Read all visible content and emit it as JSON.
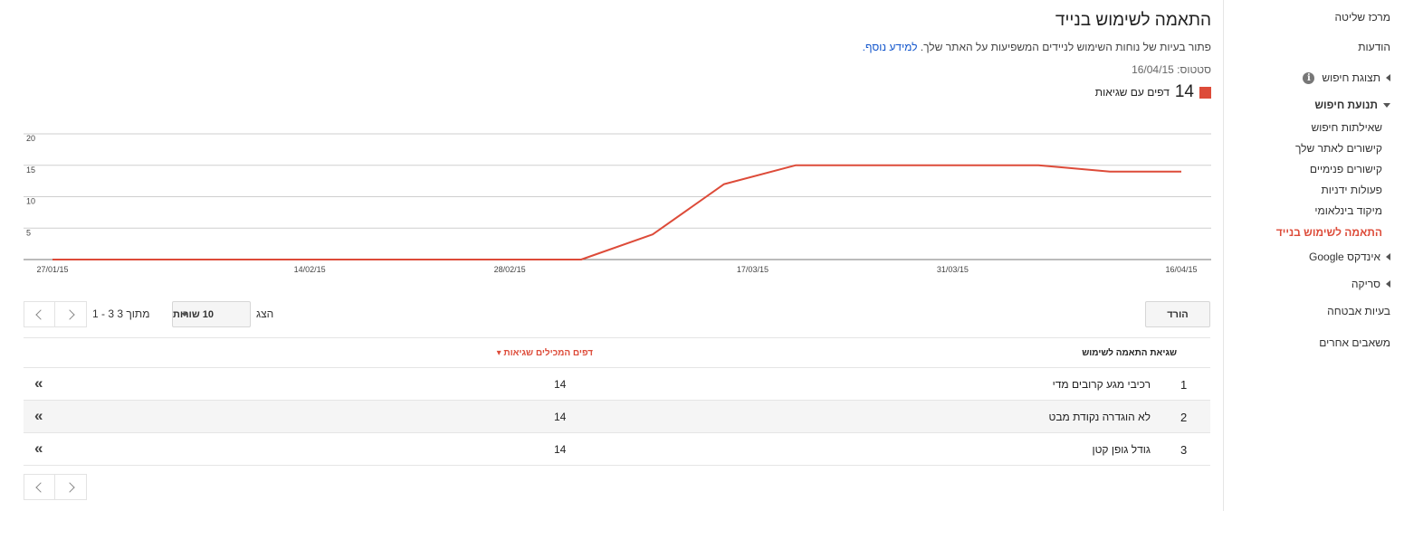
{
  "sidebar": {
    "items": [
      {
        "label": "מרכז שליטה"
      },
      {
        "label": "הודעות"
      },
      {
        "label": "תצוגת חיפוש"
      },
      {
        "label": "תנועת חיפוש"
      },
      {
        "label": "שאילתות חיפוש"
      },
      {
        "label": "קישורים לאתר שלך"
      },
      {
        "label": "קישורים פנימיים"
      },
      {
        "label": "פעולות ידניות"
      },
      {
        "label": "מיקוד בינלאומי"
      },
      {
        "label": "התאמה לשימוש בנייד"
      },
      {
        "label": "אינדקס Google"
      },
      {
        "label": "סריקה"
      },
      {
        "label": "בעיות אבטחה"
      },
      {
        "label": "משאבים אחרים"
      }
    ],
    "info_icon": "i"
  },
  "header": {
    "title": "התאמה לשימוש בנייד",
    "description": "פתור בעיות של נוחות השימוש לניידים המשפיעות על האתר שלך.",
    "learn_more": "למידע נוסף.",
    "status_label": "סטטוס:",
    "status_date": "16/04/15"
  },
  "legend": {
    "count": "14",
    "label": "דפים עם שגיאות",
    "color": "#dd4b39"
  },
  "chart_data": {
    "type": "line",
    "x_ticks": [
      "27/01/15",
      "14/02/15",
      "28/02/15",
      "17/03/15",
      "31/03/15",
      "16/04/15"
    ],
    "y_ticks": [
      "5",
      "10",
      "15",
      "20"
    ],
    "ylim": [
      0,
      20
    ],
    "grid": true,
    "series": [
      {
        "color": "#dd4b39",
        "points": [
          {
            "x": "27/01/15",
            "y": 0
          },
          {
            "x": "05/03/15",
            "y": 0
          },
          {
            "x": "10/03/15",
            "y": 4
          },
          {
            "x": "15/03/15",
            "y": 12
          },
          {
            "x": "20/03/15",
            "y": 15
          },
          {
            "x": "06/04/15",
            "y": 15
          },
          {
            "x": "11/04/15",
            "y": 14
          },
          {
            "x": "16/04/15",
            "y": 14
          }
        ]
      }
    ]
  },
  "controls": {
    "download_label": "הורד",
    "show_label": "הצג",
    "rows_value": "10 שורות",
    "range_text": "1 - 3 מתוך 3"
  },
  "table": {
    "headers": {
      "error": "שגיאת התאמה לשימוש",
      "pages": "דפים המכילים שגיאות ▾"
    },
    "rows": [
      {
        "index": "1",
        "name": "רכיבי מגע קרובים מדי",
        "value": "14"
      },
      {
        "index": "2",
        "name": "לא הוגדרה נקודת מבט",
        "value": "14"
      },
      {
        "index": "3",
        "name": "גודל גופן קטן",
        "value": "14"
      }
    ],
    "more_glyph": "«"
  }
}
